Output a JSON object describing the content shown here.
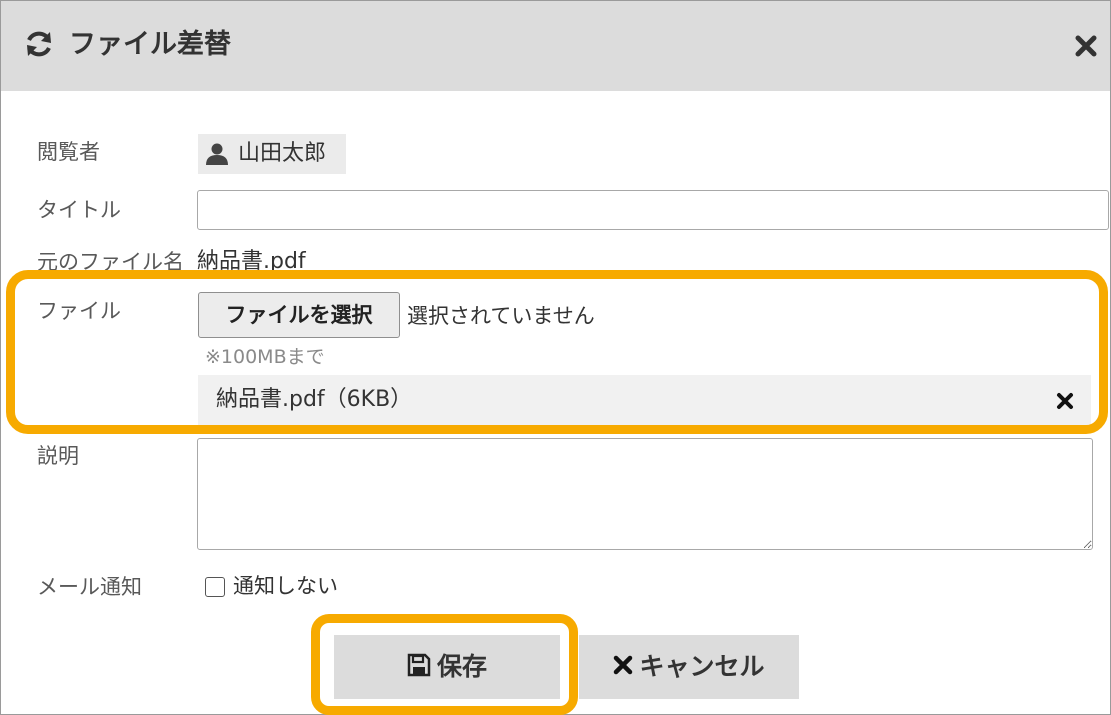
{
  "dialog": {
    "title": "ファイル差替",
    "refresh_icon": "refresh-icon",
    "close_icon": "close-icon"
  },
  "form": {
    "viewer_label": "閲覧者",
    "viewer_name": "山田太郎",
    "viewer_icon": "user-icon",
    "title_label": "タイトル",
    "title_value": "",
    "original_label": "元のファイル名",
    "original_value": "納品書.pdf",
    "file_label": "ファイル",
    "file_button": "ファイルを選択",
    "file_status": "選択されていません",
    "file_note": "※100MBまで",
    "attached_file": "納品書.pdf（6KB）",
    "description_label": "説明",
    "description_value": "",
    "mail_label": "メール通知",
    "mail_checkbox_label": "通知しない",
    "mail_checkbox_checked": false
  },
  "buttons": {
    "save": "保存",
    "cancel": "キャンセル"
  },
  "colors": {
    "highlight": "#f7aa00",
    "header_bg": "#dcdcdc"
  }
}
